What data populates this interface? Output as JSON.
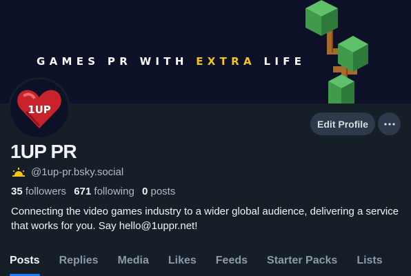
{
  "banner": {
    "text_before": "GAMES PR WITH ",
    "text_highlight": "EXTRA",
    "text_after": " LIFE",
    "highlight_color": "#f5c518"
  },
  "avatar": {
    "text": "1UP"
  },
  "actions": {
    "edit_profile_label": "Edit Profile",
    "more_icon": "more-horizontal-icon"
  },
  "profile": {
    "display_name": "1UP PR",
    "handle_icon": "sunrise-icon",
    "handle": "@1up-pr.bsky.social",
    "bio": "Connecting the video games industry to a wider global audience, delivering a service that works for you. Say hello@1uppr.net!"
  },
  "stats": {
    "followers_count": "35",
    "followers_label": "followers",
    "following_count": "671",
    "following_label": "following",
    "posts_count": "0",
    "posts_label": "posts"
  },
  "tabs": [
    {
      "label": "Posts",
      "active": true
    },
    {
      "label": "Replies",
      "active": false
    },
    {
      "label": "Media",
      "active": false
    },
    {
      "label": "Likes",
      "active": false
    },
    {
      "label": "Feeds",
      "active": false
    },
    {
      "label": "Starter Packs",
      "active": false
    },
    {
      "label": "Lists",
      "active": false
    }
  ],
  "colors": {
    "background": "#161e27",
    "banner_background": "#0d1128",
    "accent": "#1083fe",
    "button_background": "#2c3a4b"
  }
}
